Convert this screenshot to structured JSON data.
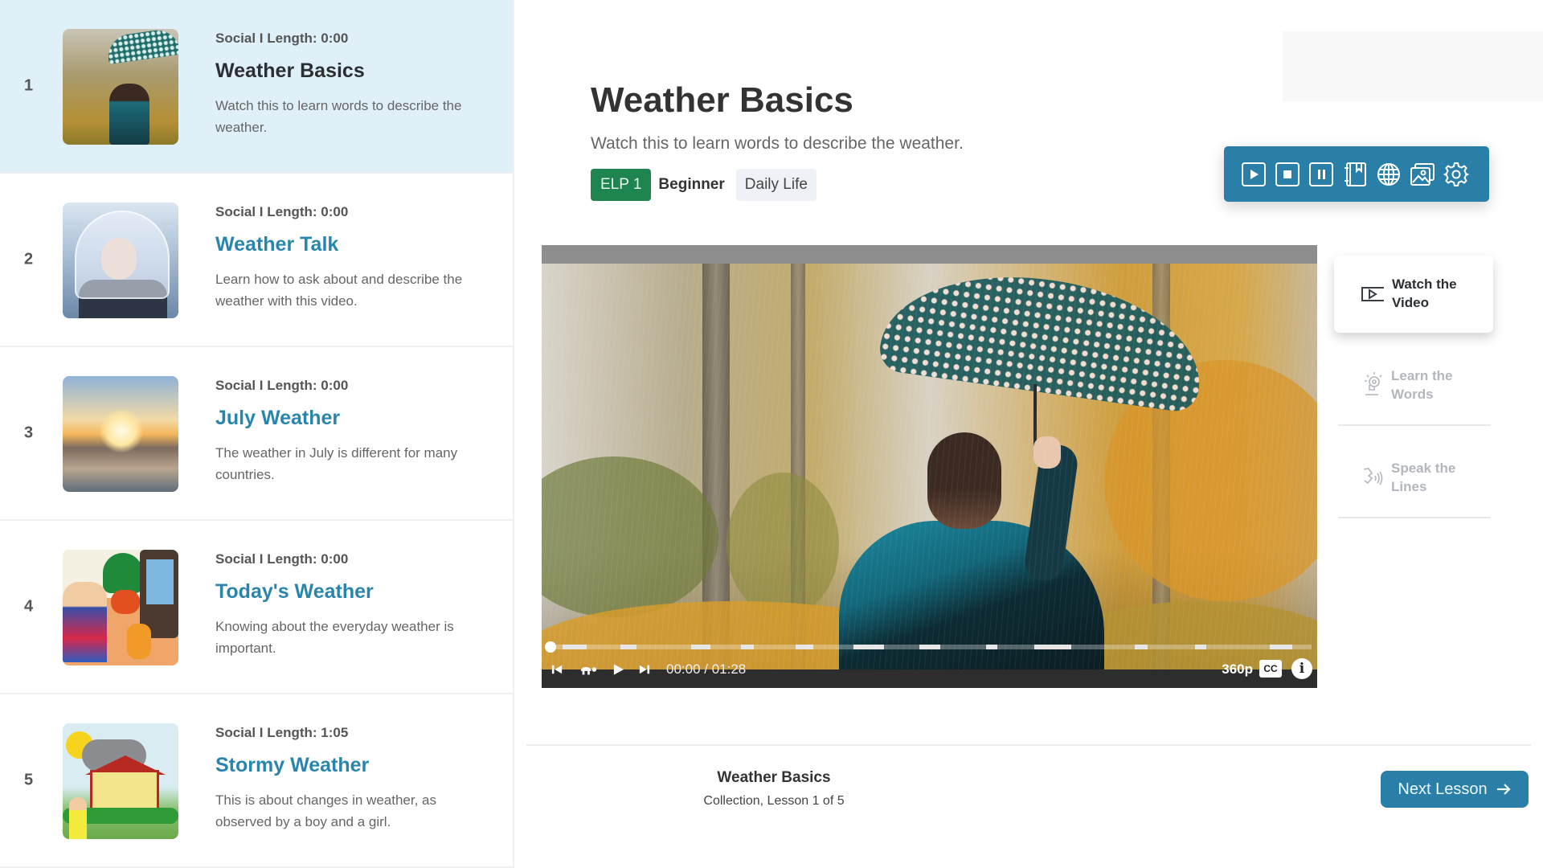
{
  "sidebar": {
    "lessons": [
      {
        "number": "1",
        "meta": "Social I Length: 0:00",
        "title": "Weather Basics",
        "description": "Watch this to learn words to describe the weather.",
        "active": true
      },
      {
        "number": "2",
        "meta": "Social I Length: 0:00",
        "title": "Weather Talk",
        "description": "Learn how to ask about and describe the weather with this video.",
        "active": false
      },
      {
        "number": "3",
        "meta": "Social I Length: 0:00",
        "title": "July Weather",
        "description": "The weather in July is different for many countries.",
        "active": false
      },
      {
        "number": "4",
        "meta": "Social I Length: 0:00",
        "title": "Today's Weather",
        "description": "Knowing about the everyday weather is important.",
        "active": false
      },
      {
        "number": "5",
        "meta": "Social I Length: 1:05",
        "title": "Stormy Weather",
        "description": "This is about changes in weather, as observed by a boy and a girl.",
        "active": false
      }
    ]
  },
  "header": {
    "title": "Weather Basics",
    "description": "Watch this to learn words to describe the weather.",
    "badges": {
      "level_code": "ELP 1",
      "level_name": "Beginner",
      "topic": "Daily Life"
    }
  },
  "toolbar": {
    "buttons": [
      {
        "icon": "play-icon",
        "label": "Play"
      },
      {
        "icon": "stop-icon",
        "label": "Stop"
      },
      {
        "icon": "pause-icon",
        "label": "Pause"
      },
      {
        "icon": "dictionary-icon",
        "label": "Dictionary"
      },
      {
        "icon": "globe-icon",
        "label": "Translate"
      },
      {
        "icon": "image-icon",
        "label": "Picture dictionary"
      },
      {
        "icon": "gear-icon",
        "label": "Settings"
      }
    ]
  },
  "video": {
    "current_time": "00:00",
    "duration": "01:28",
    "time_display": "00:00 / 01:28",
    "progress_fraction": 0,
    "quality": "360p",
    "cc_label": "CC",
    "info_label": "i"
  },
  "steps": [
    {
      "label": "Watch the Video",
      "icon": "video-play-icon",
      "active": true
    },
    {
      "label": "Learn the Words",
      "icon": "lightbulb-head-icon",
      "active": false
    },
    {
      "label": "Speak the Lines",
      "icon": "speaking-icon",
      "active": false
    }
  ],
  "footer": {
    "collection_title": "Weather Basics",
    "collection_progress": "Collection, Lesson 1 of 5",
    "next_button": "Next Lesson",
    "next_icon": "arrow-right-icon"
  },
  "colors": {
    "primary": "#2a7fa8",
    "level_badge": "#1e8450",
    "active_lesson_bg": "#dff0f9",
    "lesson_title": "#2a85ad"
  }
}
